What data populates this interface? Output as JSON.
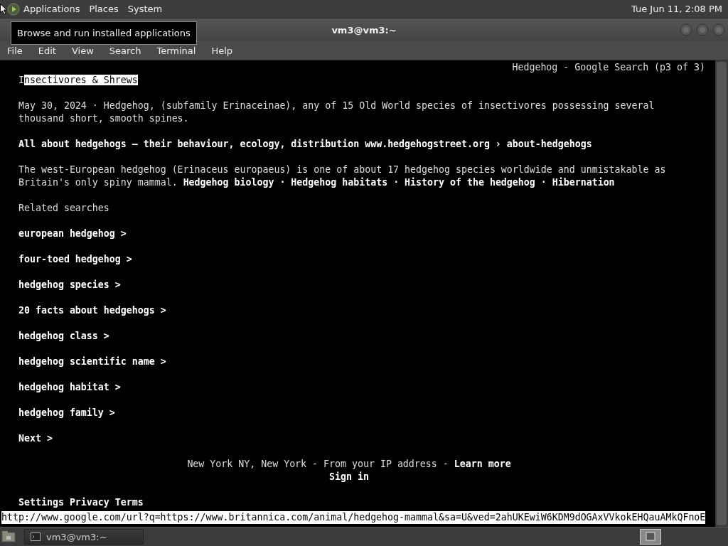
{
  "top_panel": {
    "menus": [
      "Applications",
      "Places",
      "System"
    ],
    "clock": "Tue Jun 11,  2:08 PM"
  },
  "tooltip": "Browse and run installed applications",
  "window": {
    "title": "vm3@vm3:~"
  },
  "menu_bar": [
    "File",
    "Edit",
    "View",
    "Search",
    "Terminal",
    "Help"
  ],
  "terminal": {
    "page_title": "Hedgehog - Google Search (p3 of 3)",
    "blocks": [
      {
        "lines": [
          {
            "prefix": "I",
            "link": "nsectivores & Shrews",
            "selected": true
          }
        ]
      },
      {
        "lines": [
          {
            "text": "May 30, 2024 · Hedgehog, (subfamily Erinaceinae), any of 15 Old World species of insectivores possessing several"
          },
          {
            "text": "thousand short, smooth spines."
          }
        ]
      },
      {
        "lines": [
          {
            "text": "All about hedgehogs – their behaviour, ecology, distribution www.hedgehogstreet.org › about-hedgehogs",
            "bold": true
          }
        ]
      },
      {
        "lines": [
          {
            "text": "The west-European hedgehog (Erinaceus europaeus) is one of about 17 hedgehog species worldwide and unmistakable as"
          },
          {
            "text": "Britain's only spiny mammal. **Hedgehog biology · Hedgehog habitats · History of the hedgehog · Hibernation**"
          }
        ]
      },
      {
        "lines": [
          {
            "text": "Related searches"
          }
        ]
      },
      {
        "lines": [
          {
            "text": "european hedgehog >",
            "bold": true
          }
        ]
      },
      {
        "lines": [
          {
            "text": "four-toed hedgehog >",
            "bold": true
          }
        ]
      },
      {
        "lines": [
          {
            "text": "hedgehog species >",
            "bold": true
          }
        ]
      },
      {
        "lines": [
          {
            "text": "20 facts about hedgehogs >",
            "bold": true
          }
        ]
      },
      {
        "lines": [
          {
            "text": "hedgehog class >",
            "bold": true
          }
        ]
      },
      {
        "lines": [
          {
            "text": "hedgehog scientific name >",
            "bold": true
          }
        ]
      },
      {
        "lines": [
          {
            "text": "hedgehog habitat >",
            "bold": true
          }
        ]
      },
      {
        "lines": [
          {
            "text": "hedgehog family >",
            "bold": true
          }
        ]
      },
      {
        "lines": [
          {
            "text": "Next >",
            "bold": true
          }
        ]
      },
      {
        "centered": true,
        "lines": [
          {
            "text": "New York NY, New York - From your IP address - **Learn more**"
          },
          {
            "text": "Sign in",
            "bold": true
          }
        ]
      },
      {
        "lines": [
          {
            "text": "Settings Privacy Terms",
            "bold": true
          }
        ]
      }
    ],
    "status_line": "http://www.google.com/url?q=https://www.britannica.com/animal/hedgehog-mammal&sa=U&ved=2ahUKEwiW6KDM9dOGAxVVkokEHQauAMkQFnoE"
  },
  "taskbar": {
    "tasks": [
      {
        "label": "vm3@vm3:~",
        "selected": false
      }
    ]
  }
}
